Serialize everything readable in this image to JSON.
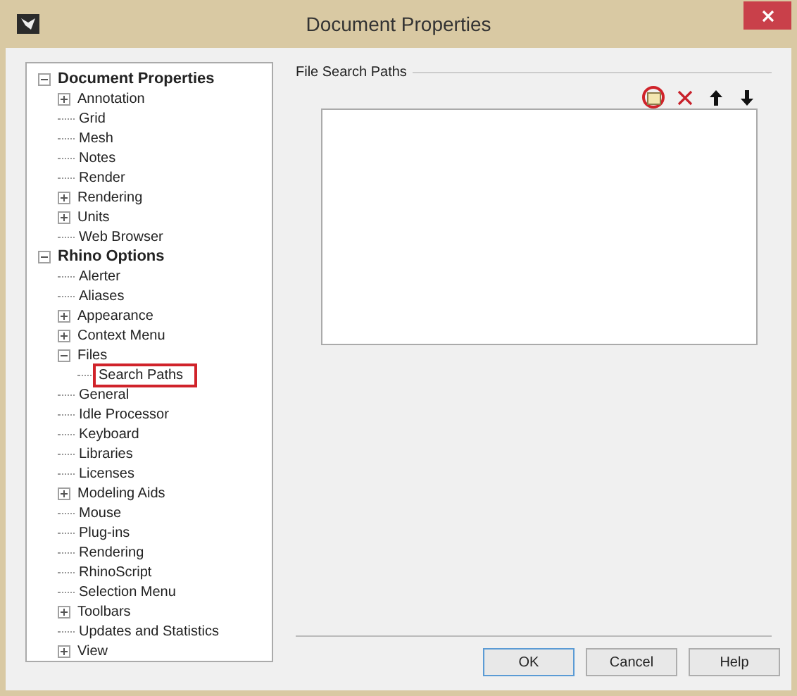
{
  "window": {
    "title": "Document Properties"
  },
  "tree": [
    {
      "label": "Document Properties",
      "bold": true,
      "expanded": true,
      "children": [
        {
          "label": "Annotation",
          "expanded": false
        },
        {
          "label": "Grid"
        },
        {
          "label": "Mesh"
        },
        {
          "label": "Notes"
        },
        {
          "label": "Render"
        },
        {
          "label": "Rendering",
          "expanded": false
        },
        {
          "label": "Units",
          "expanded": false
        },
        {
          "label": "Web Browser"
        }
      ]
    },
    {
      "label": "Rhino Options",
      "bold": true,
      "expanded": true,
      "children": [
        {
          "label": "Alerter"
        },
        {
          "label": "Aliases"
        },
        {
          "label": "Appearance",
          "expanded": false
        },
        {
          "label": "Context Menu",
          "expanded": false
        },
        {
          "label": "Files",
          "expanded": true,
          "children": [
            {
              "label": "Search Paths",
              "selected": true
            }
          ]
        },
        {
          "label": "General"
        },
        {
          "label": "Idle Processor"
        },
        {
          "label": "Keyboard"
        },
        {
          "label": "Libraries"
        },
        {
          "label": "Licenses"
        },
        {
          "label": "Modeling Aids",
          "expanded": false
        },
        {
          "label": "Mouse"
        },
        {
          "label": "Plug-ins"
        },
        {
          "label": "Rendering"
        },
        {
          "label": "RhinoScript"
        },
        {
          "label": "Selection Menu"
        },
        {
          "label": "Toolbars",
          "expanded": false
        },
        {
          "label": "Updates and Statistics"
        },
        {
          "label": "View",
          "expanded": false
        }
      ]
    }
  ],
  "group": {
    "title": "File Search Paths"
  },
  "toolbar": [
    {
      "kind": "add",
      "circled": true
    },
    {
      "kind": "delete",
      "circled": false
    },
    {
      "kind": "up",
      "circled": false
    },
    {
      "kind": "down",
      "circled": false
    }
  ],
  "buttons": [
    {
      "label": "OK",
      "default": true
    },
    {
      "label": "Cancel",
      "default": false
    },
    {
      "label": "Help",
      "default": false
    }
  ]
}
